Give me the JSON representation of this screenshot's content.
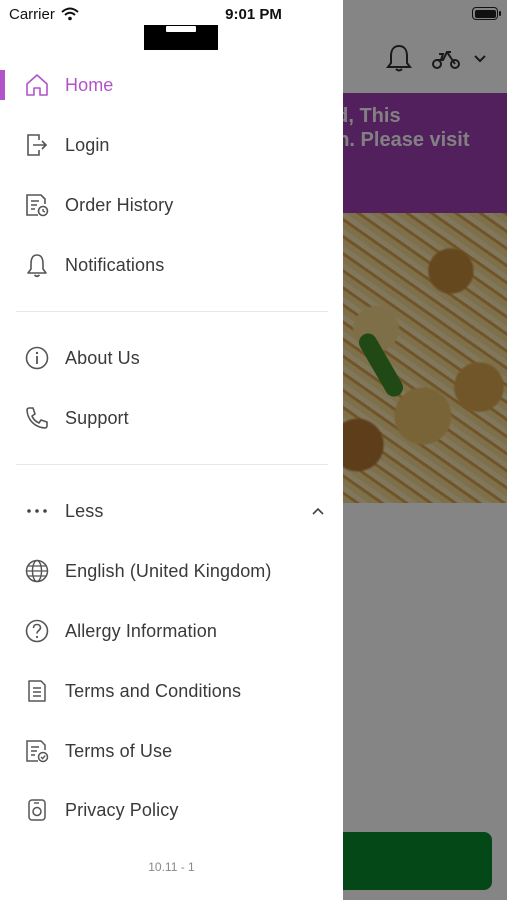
{
  "status_bar": {
    "carrier": "Carrier",
    "time": "9:01 PM"
  },
  "background": {
    "banner_text": "ed, This\non. Please visit\n/",
    "banner_color": "#9b3fb3",
    "action_button_color": "#0b8a2e"
  },
  "drawer": {
    "accent": "#b154c9",
    "items": [
      {
        "label": "Home",
        "icon": "home-icon",
        "active": true
      },
      {
        "label": "Login",
        "icon": "login-icon"
      },
      {
        "label": "Order History",
        "icon": "order-history-icon"
      },
      {
        "label": "Notifications",
        "icon": "bell-icon"
      },
      {
        "label": "About Us",
        "icon": "info-icon"
      },
      {
        "label": "Support",
        "icon": "phone-icon"
      },
      {
        "label": "Less",
        "icon": "more-dots-icon"
      },
      {
        "label": "English (United Kingdom)",
        "icon": "globe-icon"
      },
      {
        "label": "Allergy Information",
        "icon": "question-icon"
      },
      {
        "label": "Terms and Conditions",
        "icon": "document-icon"
      },
      {
        "label": "Terms of Use",
        "icon": "document-check-icon"
      },
      {
        "label": "Privacy Policy",
        "icon": "privacy-icon"
      }
    ],
    "version": "10.11 - 1"
  }
}
